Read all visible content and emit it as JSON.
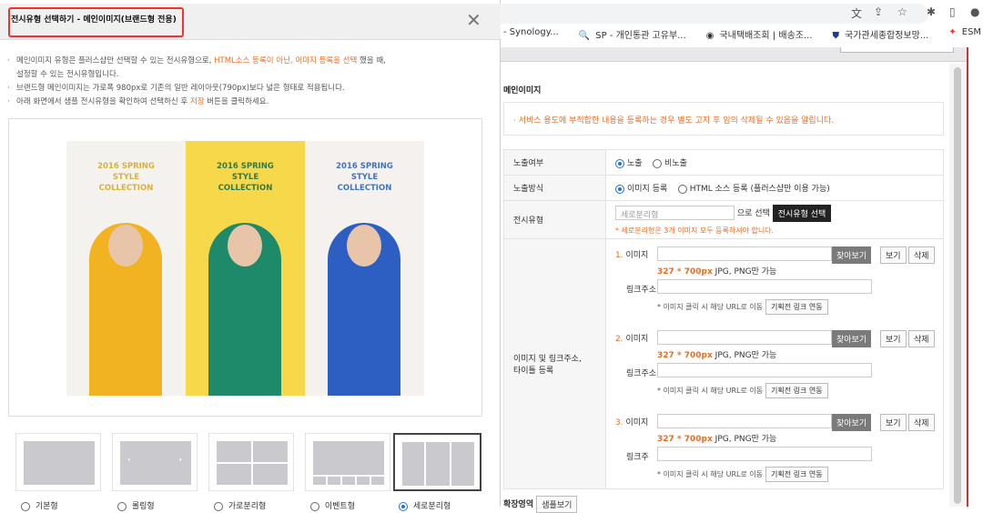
{
  "browser": {
    "bookmarks": [
      {
        "icon": "synology-icon",
        "label": "- Synology..."
      },
      {
        "icon": "magnifier-icon",
        "label": "SP - 개인통관 고유부..."
      },
      {
        "icon": "globe-icon",
        "label": "국내택배조회 | 배송조..."
      },
      {
        "icon": "shield-icon",
        "label": "국가관세종합정보망..."
      },
      {
        "icon": "esm-icon",
        "label": "ESM"
      }
    ]
  },
  "page": {
    "section_title": "메인이미지",
    "notice": "·  서비스 용도에 부적합한 내용을 등록하는 경우 별도 고지 후 임의 삭제될 수 있음을 알립니다.",
    "rows": {
      "exposure": {
        "label": "노출여부",
        "options": [
          "노출",
          "비노출"
        ],
        "selected": "노출"
      },
      "method": {
        "label": "노출방식",
        "options": [
          "이미지 등록",
          "HTML 소스 등록 (플러스샵만 이용 가능)"
        ],
        "selected": "이미지 등록"
      },
      "type": {
        "label": "전시유형",
        "value": "세로분리형",
        "suffix": "으로 선택",
        "button": "전시유형 선택",
        "warning": "* 세로분리형은 3개 이미지 모두 등록하셔야 합니다."
      },
      "images": {
        "label_line1": "이미지 및 링크주소,",
        "label_line2": "타이틀 등록",
        "items": [
          {
            "num": "1.",
            "label": "이미지",
            "find": "찾아보기",
            "view": "보기",
            "delete": "삭제",
            "size": "327 * 700px",
            "format": "JPG, PNG만 가능",
            "link_label": "링크주소",
            "link_note": "* 이미지 클릭 시 해당 URL로 이동",
            "link_button": "기획전 링크 연동"
          },
          {
            "num": "2.",
            "label": "이미지",
            "find": "찾아보기",
            "view": "보기",
            "delete": "삭제",
            "size": "327 * 700px",
            "format": "JPG, PNG만 가능",
            "link_label": "링크주소",
            "link_note": "* 이미지 클릭 시 해당 URL로 이동",
            "link_button": "기획전 링크 연동"
          },
          {
            "num": "3.",
            "label": "이미지",
            "find": "찾아보기",
            "view": "보기",
            "delete": "삭제",
            "size": "327 * 700px",
            "format": "JPG, PNG만 가능",
            "link_label": "링크주",
            "link_note": "* 이미지 클릭 시 해당 URL로 이동",
            "link_button": "기획전 링크 연동"
          }
        ]
      }
    },
    "extension": {
      "label": "확장영역",
      "button": "샘플보기"
    }
  },
  "modal": {
    "title": "전시유형 선택하기 - 메인이미지(브랜드형 전용)",
    "desc1a": "메인이미지 유형은 플러스샵만 선택할 수 있는 전시유형으로, ",
    "desc1b": "HTML소스 등록이 아닌, 이미지 등록을 선택",
    "desc1c": " 했을 때,",
    "desc1d": "설정할 수 있는 전시유형입니다.",
    "desc2": "브랜드형 메인이미지는 가로폭 980px로 기존의 일반 레이아웃(790px)보다 넓은 형태로 적용됩니다.",
    "desc3a": "아래 화면에서 샘플 전시유형을 확인하여 선택하신 후 ",
    "desc3b": "저장",
    "desc3c": " 버튼을 클릭하세요.",
    "preview_panels": [
      {
        "text": "2016 SPRING STYLE COLLECTION",
        "color": "#d9b13c",
        "bg": "#f3f2ee"
      },
      {
        "text": "2016 SPRING STYLE COLLECTION",
        "color": "#2f7a4a",
        "bg": "#f7d84a"
      },
      {
        "text": "2016 SPRING STYLE COLLECTION",
        "color": "#3f74c2",
        "bg": "#f4f1ee"
      }
    ],
    "types": [
      {
        "label": "기본형",
        "selected": false
      },
      {
        "label": "롤링형",
        "selected": false
      },
      {
        "label": "가로분리형",
        "selected": false
      },
      {
        "label": "이벤트형",
        "selected": false
      },
      {
        "label": "세로분리형",
        "selected": true
      }
    ],
    "accent": "#f06a1c"
  }
}
